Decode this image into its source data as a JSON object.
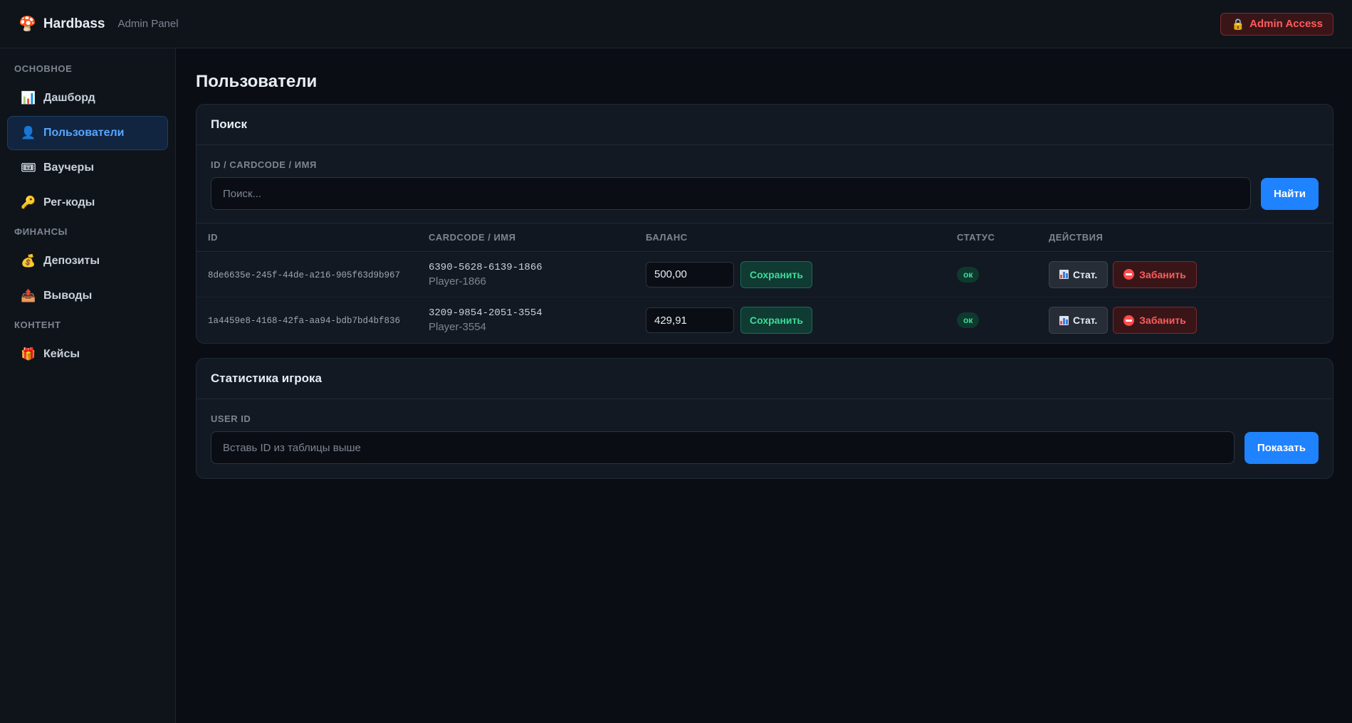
{
  "header": {
    "brand_icon": "🍄",
    "brand": "Hardbass",
    "subtitle": "Admin Panel",
    "admin_access_icon": "🔒",
    "admin_access_label": "Admin Access"
  },
  "sidebar": {
    "sections": [
      {
        "title": "ОСНОВНОЕ",
        "items": [
          {
            "icon": "📊",
            "label": "Дашборд"
          },
          {
            "icon": "👤",
            "label": "Пользователи",
            "active": true
          },
          {
            "icon": "🎟",
            "label": "Ваучеры"
          },
          {
            "icon": "🔑",
            "label": "Рег-коды"
          }
        ]
      },
      {
        "title": "ФИНАНСЫ",
        "items": [
          {
            "icon": "💰",
            "label": "Депозиты"
          },
          {
            "icon": "📤",
            "label": "Выводы"
          }
        ]
      },
      {
        "title": "КОНТЕНТ",
        "items": [
          {
            "icon": "🎁",
            "label": "Кейсы"
          }
        ]
      }
    ]
  },
  "main": {
    "title": "Пользователи",
    "search_card": {
      "title": "Поиск",
      "label": "ID / CARDCODE / ИМЯ",
      "placeholder": "Поиск...",
      "button": "Найти"
    },
    "table": {
      "headers": [
        "ID",
        "CARDCODE / ИМЯ",
        "БАЛАНС",
        "СТАТУС",
        "ДЕЙСТВИЯ"
      ],
      "rows": [
        {
          "id": "8de6635e-245f-44de-a216-905f63d9b967",
          "cardcode": "6390-5628-6139-1866",
          "name": "Player-1866",
          "balance": "500,00",
          "save_label": "Сохранить",
          "status": "ок",
          "stat_label": "Стат.",
          "ban_label": "Забанить"
        },
        {
          "id": "1a4459e8-4168-42fa-aa94-bdb7bd4bf836",
          "cardcode": "3209-9854-2051-3554",
          "name": "Player-3554",
          "balance": "429,91",
          "save_label": "Сохранить",
          "status": "ок",
          "stat_label": "Стат.",
          "ban_label": "Забанить"
        }
      ]
    },
    "stats_card": {
      "title": "Статистика игрока",
      "label": "USER ID",
      "placeholder": "Вставь ID из таблицы выше",
      "button": "Показать"
    }
  },
  "colors": {
    "background": "#0a0e14",
    "panel": "#121923",
    "accent_blue": "#1f82ff",
    "success_green": "#3ddc97",
    "danger_red": "#ff5c5c"
  }
}
